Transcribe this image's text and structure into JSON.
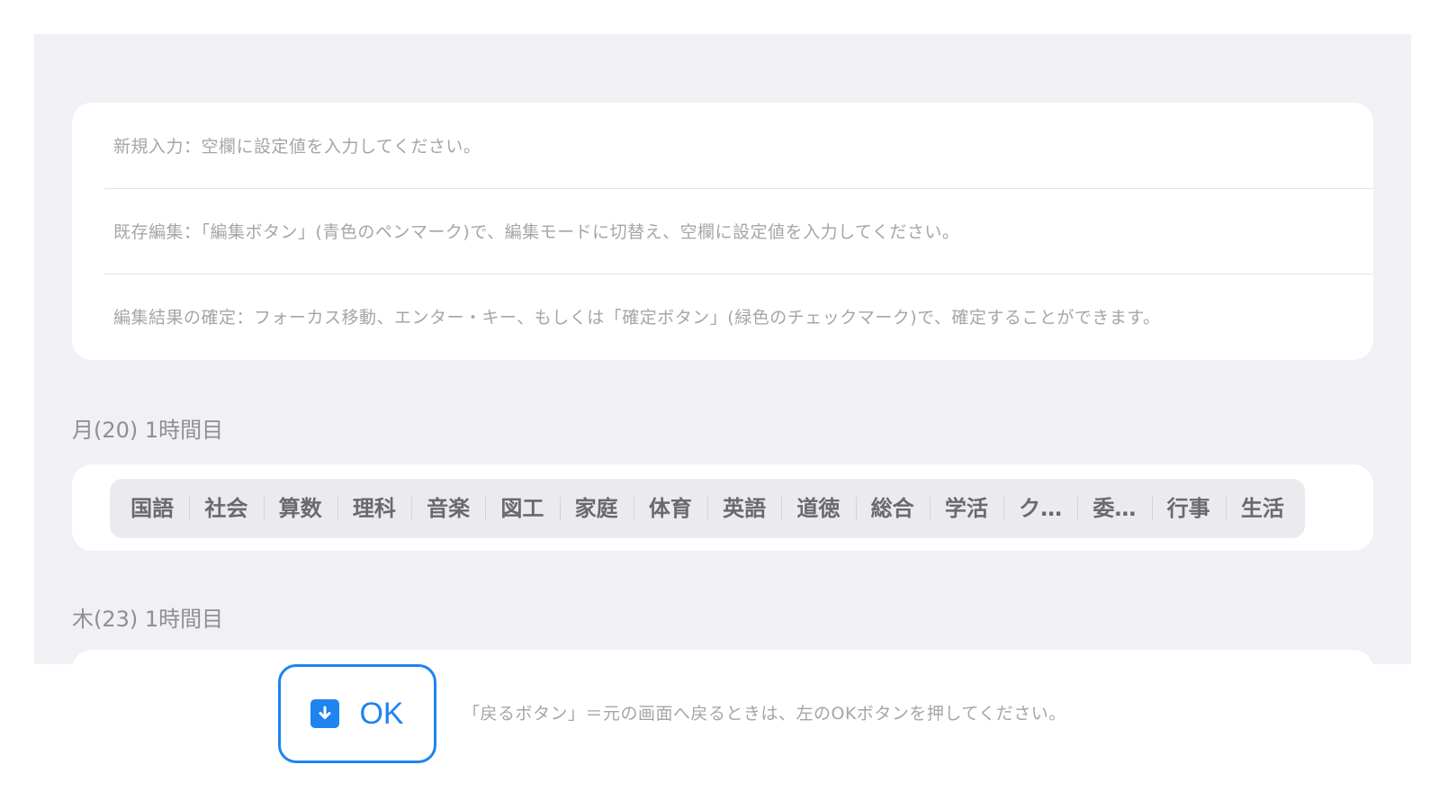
{
  "instructions": {
    "new_entry": "新規入力：空欄に設定値を入力してください。",
    "edit_existing": "既存編集：「編集ボタン」(青色のペンマーク)で、編集モードに切替え、空欄に設定値を入力してください。",
    "confirm_edit": "編集結果の確定：フォーカス移動、エンター・キー、もしくは「確定ボタン」(緑色のチェックマーク)で、確定することができます。"
  },
  "periods": [
    {
      "label": "月(20) 1時間目",
      "subjects": [
        "国語",
        "社会",
        "算数",
        "理科",
        "音楽",
        "図工",
        "家庭",
        "体育",
        "英語",
        "道徳",
        "総合",
        "学活",
        "ク…",
        "委…",
        "行事",
        "生活"
      ]
    },
    {
      "label": "木(23) 1時間目"
    }
  ],
  "footer": {
    "ok_label": "OK",
    "ok_icon": "download-arrow-icon",
    "note": "「戻るボタン」＝元の画面へ戻るときは、左のOKボタンを押してください。"
  },
  "colors": {
    "accent": "#1e84f0",
    "panel_bg": "#f0f0f5",
    "segmented_bg": "#ebebef"
  }
}
